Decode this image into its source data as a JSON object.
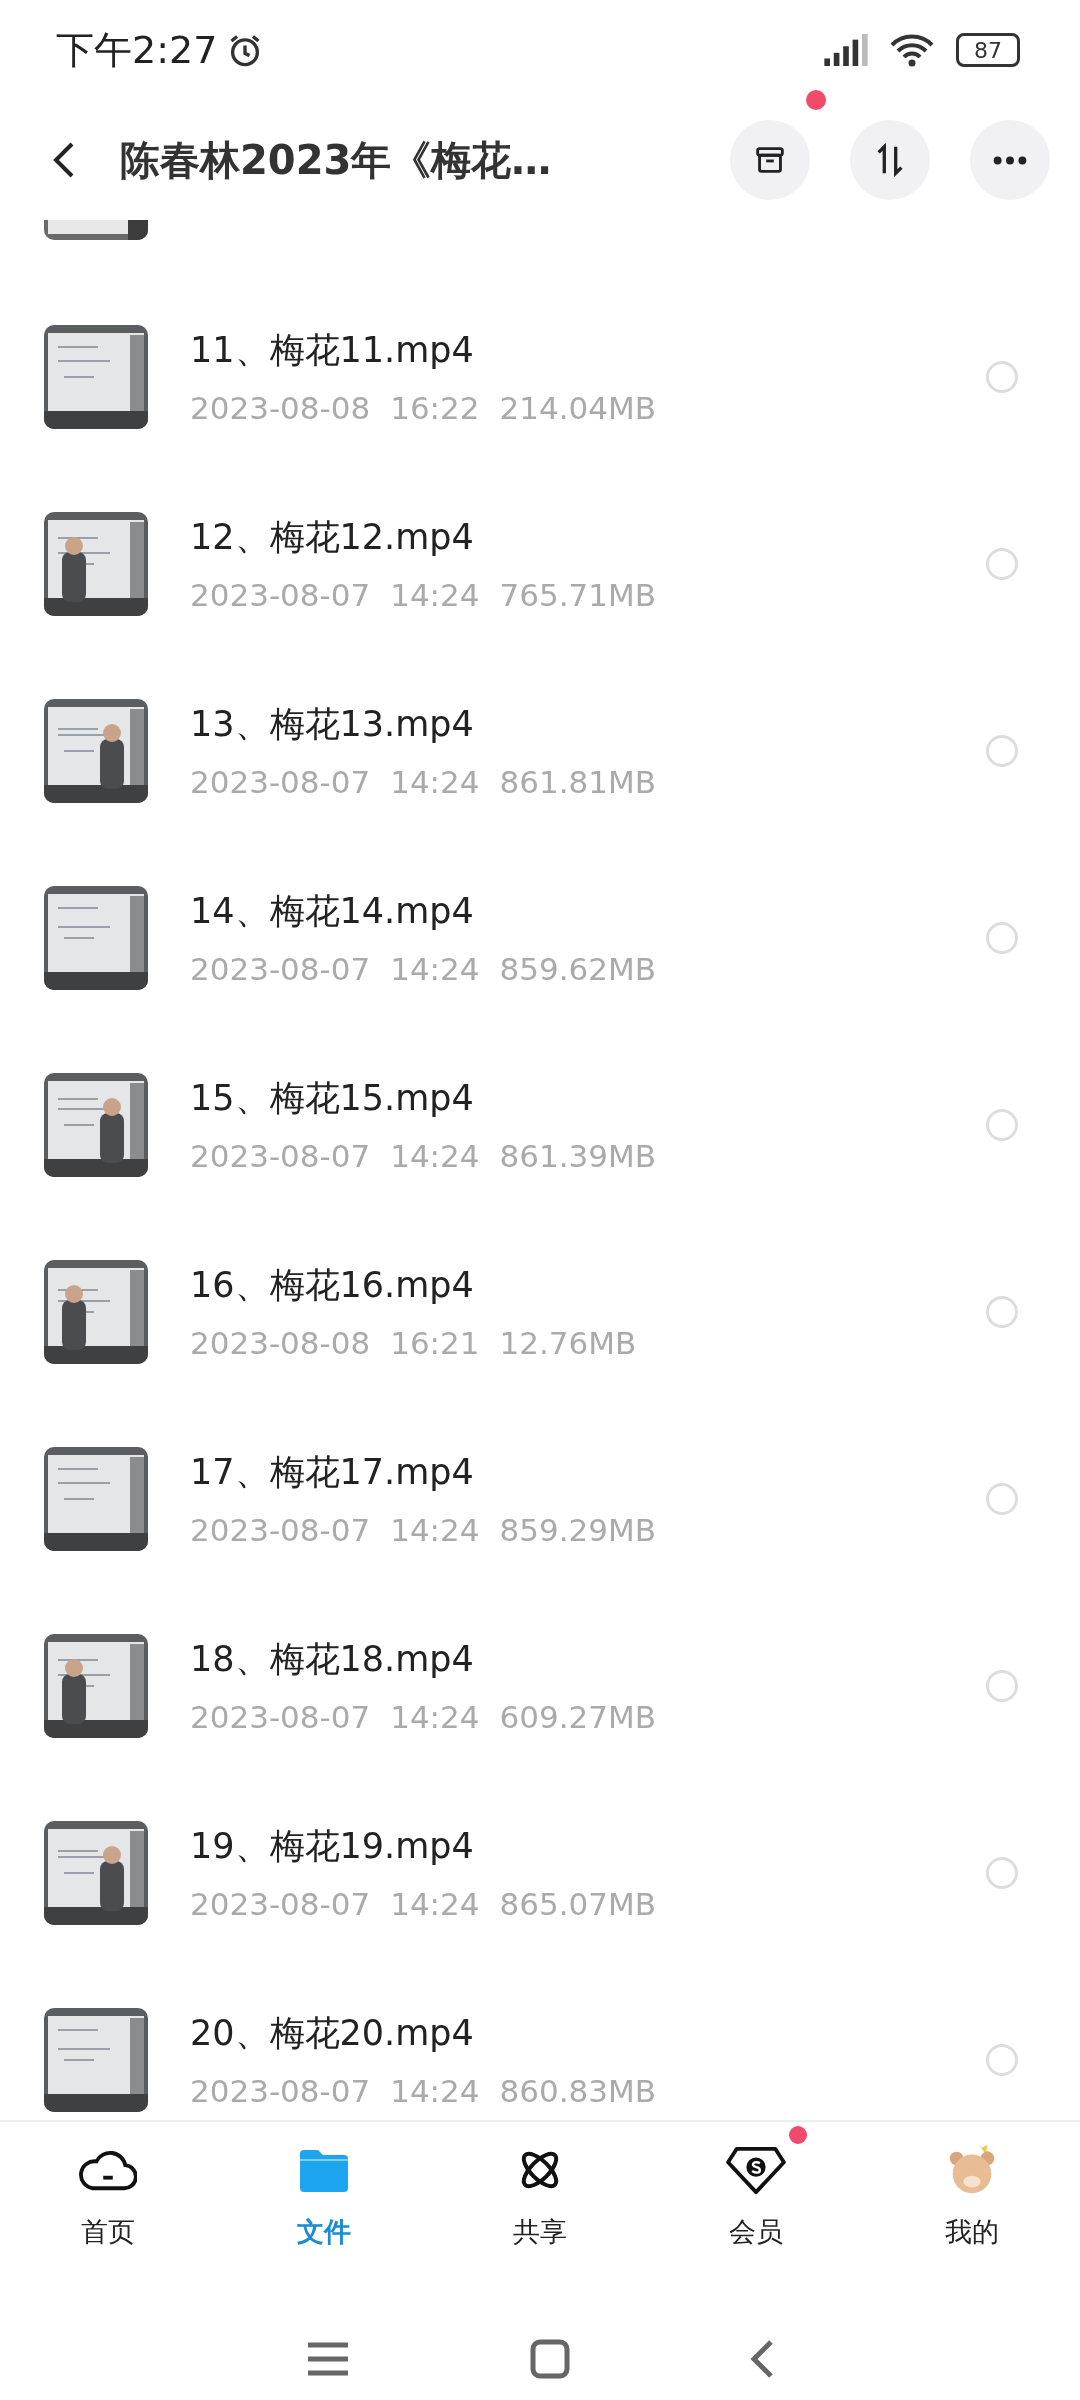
{
  "status_bar": {
    "time": "下午2:27",
    "battery": "87"
  },
  "header": {
    "title": "陈春林2023年《梅花…",
    "actions": [
      {
        "kind": "archive",
        "badge": true
      },
      {
        "kind": "sort",
        "badge": false
      },
      {
        "kind": "more",
        "badge": false
      }
    ]
  },
  "files": [
    {
      "name": "11、梅花11.mp4",
      "date": "2023-08-08",
      "time": "16:22",
      "size": "214.04MB",
      "selected": false
    },
    {
      "name": "12、梅花12.mp4",
      "date": "2023-08-07",
      "time": "14:24",
      "size": "765.71MB",
      "selected": false
    },
    {
      "name": "13、梅花13.mp4",
      "date": "2023-08-07",
      "time": "14:24",
      "size": "861.81MB",
      "selected": false
    },
    {
      "name": "14、梅花14.mp4",
      "date": "2023-08-07",
      "time": "14:24",
      "size": "859.62MB",
      "selected": false
    },
    {
      "name": "15、梅花15.mp4",
      "date": "2023-08-07",
      "time": "14:24",
      "size": "861.39MB",
      "selected": false
    },
    {
      "name": "16、梅花16.mp4",
      "date": "2023-08-08",
      "time": "16:21",
      "size": "12.76MB",
      "selected": false
    },
    {
      "name": "17、梅花17.mp4",
      "date": "2023-08-07",
      "time": "14:24",
      "size": "859.29MB",
      "selected": false
    },
    {
      "name": "18、梅花18.mp4",
      "date": "2023-08-07",
      "time": "14:24",
      "size": "609.27MB",
      "selected": false
    },
    {
      "name": "19、梅花19.mp4",
      "date": "2023-08-07",
      "time": "14:24",
      "size": "865.07MB",
      "selected": false
    },
    {
      "name": "20、梅花20.mp4",
      "date": "2023-08-07",
      "time": "14:24",
      "size": "860.83MB",
      "selected": false
    }
  ],
  "nav": [
    {
      "label": "首页",
      "kind": "home",
      "selected": false,
      "badge": false
    },
    {
      "label": "文件",
      "kind": "files",
      "selected": true,
      "badge": false
    },
    {
      "label": "共享",
      "kind": "share",
      "selected": false,
      "badge": false
    },
    {
      "label": "会员",
      "kind": "vip",
      "selected": false,
      "badge": true
    },
    {
      "label": "我的",
      "kind": "me",
      "selected": false,
      "badge": false
    }
  ]
}
